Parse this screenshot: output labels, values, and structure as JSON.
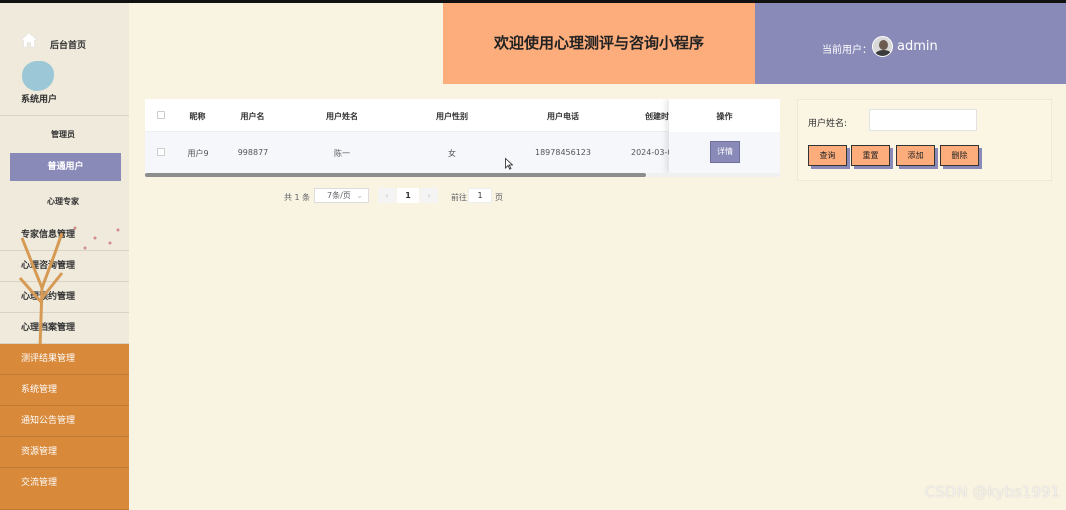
{
  "sidebar": {
    "home_label": "后台首页",
    "system_user": "系统用户",
    "admin": "管理员",
    "normal_user": "普通用户",
    "expert": "心理专家",
    "items": [
      {
        "label": "专家信息管理"
      },
      {
        "label": "心理咨询管理"
      },
      {
        "label": "心理预约管理"
      },
      {
        "label": "心理档案管理"
      }
    ],
    "orange_items": [
      {
        "label": "测评结果管理"
      },
      {
        "label": "系统管理"
      },
      {
        "label": "通知公告管理"
      },
      {
        "label": "资源管理"
      },
      {
        "label": "交流管理"
      }
    ]
  },
  "header": {
    "title": "欢迎使用心理测评与咨询小程序",
    "current_user_label": "当前用户：",
    "username": "admin"
  },
  "table": {
    "columns": [
      "昵称",
      "用户名",
      "用户姓名",
      "用户性别",
      "用户电话",
      "创建时"
    ],
    "action_header": "操作",
    "rows": [
      {
        "nickname": "用户9",
        "username": "998877",
        "name": "陈一",
        "gender": "女",
        "phone": "18978456123",
        "created": "2024-03-0",
        "action": "详情"
      }
    ]
  },
  "pagination": {
    "total": "共 1 条",
    "page_size": "7条/页",
    "prev": "‹",
    "current": "1",
    "next": "›",
    "goto_label": "前往",
    "goto_value": "1",
    "page_suffix": "页"
  },
  "search": {
    "label": "用户姓名:",
    "value": "",
    "buttons": {
      "query": "查询",
      "reset": "重置",
      "add": "添加",
      "delete": "删除"
    }
  },
  "watermark": "CSDN @kybs1991",
  "colors": {
    "accent_orange": "#fdad7c",
    "accent_purple": "#8a8ab9",
    "sidebar_orange": "#d8893a",
    "background": "#f9f3e2"
  }
}
